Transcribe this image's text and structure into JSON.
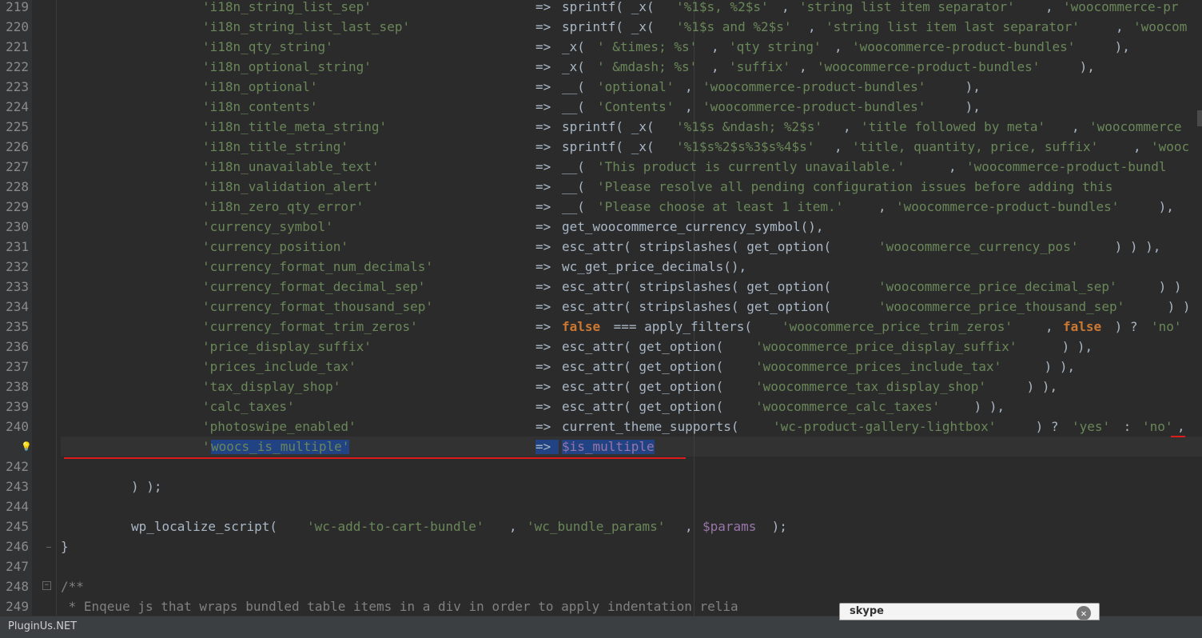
{
  "brand": "PluginUs.NET",
  "popup": {
    "logo": "skype",
    "close_glyph": "✕"
  },
  "lines": [
    {
      "n": "219",
      "tokens": [
        {
          "t": "'i18n_string_list_sep'",
          "c": "s"
        },
        {
          "t": "=> ",
          "c": "p",
          "col": 670
        },
        {
          "t": "sprintf( _x( ",
          "c": "p"
        },
        {
          "t": "'%1$s, %2$s'",
          "c": "s"
        },
        {
          "t": ", ",
          "c": "p"
        },
        {
          "t": "'string list item separator'",
          "c": "s"
        },
        {
          "t": ", ",
          "c": "p"
        },
        {
          "t": "'woocommerce-pr",
          "c": "s"
        }
      ]
    },
    {
      "n": "220",
      "tokens": [
        {
          "t": "'i18n_string_list_last_sep'",
          "c": "s"
        },
        {
          "t": "=> ",
          "c": "p",
          "col": 670
        },
        {
          "t": "sprintf( _x( ",
          "c": "p"
        },
        {
          "t": "'%1$s and %2$s'",
          "c": "s"
        },
        {
          "t": ", ",
          "c": "p"
        },
        {
          "t": "'string list item last separator'",
          "c": "s"
        },
        {
          "t": ", ",
          "c": "p"
        },
        {
          "t": "'woocom",
          "c": "s"
        }
      ]
    },
    {
      "n": "221",
      "tokens": [
        {
          "t": "'i18n_qty_string'",
          "c": "s"
        },
        {
          "t": "=> ",
          "c": "p",
          "col": 670
        },
        {
          "t": "_x( ",
          "c": "p"
        },
        {
          "t": "' &times; %s'",
          "c": "s"
        },
        {
          "t": ", ",
          "c": "p"
        },
        {
          "t": "'qty string'",
          "c": "s"
        },
        {
          "t": ", ",
          "c": "p"
        },
        {
          "t": "'woocommerce-product-bundles'",
          "c": "s"
        },
        {
          "t": " ),",
          "c": "p"
        }
      ]
    },
    {
      "n": "222",
      "tokens": [
        {
          "t": "'i18n_optional_string'",
          "c": "s"
        },
        {
          "t": "=> ",
          "c": "p",
          "col": 670
        },
        {
          "t": "_x( ",
          "c": "p"
        },
        {
          "t": "' &mdash; %s'",
          "c": "s"
        },
        {
          "t": ", ",
          "c": "p"
        },
        {
          "t": "'suffix'",
          "c": "s"
        },
        {
          "t": ", ",
          "c": "p"
        },
        {
          "t": "'woocommerce-product-bundles'",
          "c": "s"
        },
        {
          "t": " ),",
          "c": "p"
        }
      ]
    },
    {
      "n": "223",
      "tokens": [
        {
          "t": "'i18n_optional'",
          "c": "s"
        },
        {
          "t": "=> ",
          "c": "p",
          "col": 670
        },
        {
          "t": "__( ",
          "c": "p"
        },
        {
          "t": "'optional'",
          "c": "s"
        },
        {
          "t": ", ",
          "c": "p"
        },
        {
          "t": "'woocommerce-product-bundles'",
          "c": "s"
        },
        {
          "t": " ),",
          "c": "p"
        }
      ]
    },
    {
      "n": "224",
      "tokens": [
        {
          "t": "'i18n_contents'",
          "c": "s"
        },
        {
          "t": "=> ",
          "c": "p",
          "col": 670
        },
        {
          "t": "__( ",
          "c": "p"
        },
        {
          "t": "'Contents'",
          "c": "s"
        },
        {
          "t": ", ",
          "c": "p"
        },
        {
          "t": "'woocommerce-product-bundles'",
          "c": "s"
        },
        {
          "t": " ),",
          "c": "p"
        }
      ]
    },
    {
      "n": "225",
      "tokens": [
        {
          "t": "'i18n_title_meta_string'",
          "c": "s"
        },
        {
          "t": "=> ",
          "c": "p",
          "col": 670
        },
        {
          "t": "sprintf( _x( ",
          "c": "p"
        },
        {
          "t": "'%1$s &ndash; %2$s'",
          "c": "s"
        },
        {
          "t": ", ",
          "c": "p"
        },
        {
          "t": "'title followed by meta'",
          "c": "s"
        },
        {
          "t": ", ",
          "c": "p"
        },
        {
          "t": "'woocommerce",
          "c": "s"
        }
      ]
    },
    {
      "n": "226",
      "tokens": [
        {
          "t": "'i18n_title_string'",
          "c": "s"
        },
        {
          "t": "=> ",
          "c": "p",
          "col": 670
        },
        {
          "t": "sprintf( _x( ",
          "c": "p"
        },
        {
          "t": "'%1$s%2$s%3$s%4$s'",
          "c": "s"
        },
        {
          "t": ", ",
          "c": "p"
        },
        {
          "t": "'title, quantity, price, suffix'",
          "c": "s"
        },
        {
          "t": ", ",
          "c": "p"
        },
        {
          "t": "'wooc",
          "c": "s"
        }
      ]
    },
    {
      "n": "227",
      "tokens": [
        {
          "t": "'i18n_unavailable_text'",
          "c": "s"
        },
        {
          "t": "=> ",
          "c": "p",
          "col": 670
        },
        {
          "t": "__( ",
          "c": "p"
        },
        {
          "t": "'This product is currently unavailable.'",
          "c": "s"
        },
        {
          "t": ", ",
          "c": "p"
        },
        {
          "t": "'woocommerce-product-bundl",
          "c": "s"
        }
      ]
    },
    {
      "n": "228",
      "tokens": [
        {
          "t": "'i18n_validation_alert'",
          "c": "s"
        },
        {
          "t": "=> ",
          "c": "p",
          "col": 670
        },
        {
          "t": "__( ",
          "c": "p"
        },
        {
          "t": "'Please resolve all pending configuration issues before adding this",
          "c": "s"
        }
      ]
    },
    {
      "n": "229",
      "tokens": [
        {
          "t": "'i18n_zero_qty_error'",
          "c": "s"
        },
        {
          "t": "=> ",
          "c": "p",
          "col": 670
        },
        {
          "t": "__( ",
          "c": "p"
        },
        {
          "t": "'Please choose at least 1 item.'",
          "c": "s"
        },
        {
          "t": ", ",
          "c": "p"
        },
        {
          "t": "'woocommerce-product-bundles'",
          "c": "s"
        },
        {
          "t": " ),",
          "c": "p"
        }
      ]
    },
    {
      "n": "230",
      "tokens": [
        {
          "t": "'currency_symbol'",
          "c": "s"
        },
        {
          "t": "=> ",
          "c": "p",
          "col": 670
        },
        {
          "t": "get_woocommerce_currency_symbol(),",
          "c": "p"
        }
      ]
    },
    {
      "n": "231",
      "tokens": [
        {
          "t": "'currency_position'",
          "c": "s"
        },
        {
          "t": "=> ",
          "c": "p",
          "col": 670
        },
        {
          "t": "esc_attr( stripslashes( get_option( ",
          "c": "p"
        },
        {
          "t": "'woocommerce_currency_pos'",
          "c": "s"
        },
        {
          "t": " ) ) ),",
          "c": "p"
        }
      ]
    },
    {
      "n": "232",
      "tokens": [
        {
          "t": "'currency_format_num_decimals'",
          "c": "s"
        },
        {
          "t": "=> ",
          "c": "p",
          "col": 670
        },
        {
          "t": "wc_get_price_decimals(),",
          "c": "p"
        }
      ]
    },
    {
      "n": "233",
      "tokens": [
        {
          "t": "'currency_format_decimal_sep'",
          "c": "s"
        },
        {
          "t": "=> ",
          "c": "p",
          "col": 670
        },
        {
          "t": "esc_attr( stripslashes( get_option( ",
          "c": "p"
        },
        {
          "t": "'woocommerce_price_decimal_sep'",
          "c": "s"
        },
        {
          "t": " ) )",
          "c": "p"
        }
      ]
    },
    {
      "n": "234",
      "tokens": [
        {
          "t": "'currency_format_thousand_sep'",
          "c": "s"
        },
        {
          "t": "=> ",
          "c": "p",
          "col": 670
        },
        {
          "t": "esc_attr( stripslashes( get_option( ",
          "c": "p"
        },
        {
          "t": "'woocommerce_price_thousand_sep'",
          "c": "s"
        },
        {
          "t": " ) )",
          "c": "p"
        }
      ]
    },
    {
      "n": "235",
      "tokens": [
        {
          "t": "'currency_format_trim_zeros'",
          "c": "s"
        },
        {
          "t": "=> ",
          "c": "p",
          "col": 670
        },
        {
          "t": "false",
          "c": "k"
        },
        {
          "t": " === apply_filters( ",
          "c": "p"
        },
        {
          "t": "'woocommerce_price_trim_zeros'",
          "c": "s"
        },
        {
          "t": ", ",
          "c": "p"
        },
        {
          "t": "false",
          "c": "k"
        },
        {
          "t": " ) ? ",
          "c": "p"
        },
        {
          "t": "'no'",
          "c": "s"
        }
      ]
    },
    {
      "n": "236",
      "tokens": [
        {
          "t": "'price_display_suffix'",
          "c": "s"
        },
        {
          "t": "=> ",
          "c": "p",
          "col": 670
        },
        {
          "t": "esc_attr( get_option( ",
          "c": "p"
        },
        {
          "t": "'woocommerce_price_display_suffix'",
          "c": "s"
        },
        {
          "t": " ) ),",
          "c": "p"
        }
      ]
    },
    {
      "n": "237",
      "tokens": [
        {
          "t": "'prices_include_tax'",
          "c": "s"
        },
        {
          "t": "=> ",
          "c": "p",
          "col": 670
        },
        {
          "t": "esc_attr( get_option( ",
          "c": "p"
        },
        {
          "t": "'woocommerce_prices_include_tax'",
          "c": "s"
        },
        {
          "t": " ) ),",
          "c": "p"
        }
      ]
    },
    {
      "n": "238",
      "tokens": [
        {
          "t": "'tax_display_shop'",
          "c": "s"
        },
        {
          "t": "=> ",
          "c": "p",
          "col": 670
        },
        {
          "t": "esc_attr( get_option( ",
          "c": "p"
        },
        {
          "t": "'woocommerce_tax_display_shop'",
          "c": "s"
        },
        {
          "t": " ) ),",
          "c": "p"
        }
      ]
    },
    {
      "n": "239",
      "tokens": [
        {
          "t": "'calc_taxes'",
          "c": "s"
        },
        {
          "t": "=> ",
          "c": "p",
          "col": 670
        },
        {
          "t": "esc_attr( get_option( ",
          "c": "p"
        },
        {
          "t": "'woocommerce_calc_taxes'",
          "c": "s"
        },
        {
          "t": " ) ),",
          "c": "p"
        }
      ]
    },
    {
      "n": "240",
      "tokens": [
        {
          "t": "'photoswipe_enabled'",
          "c": "s"
        },
        {
          "t": "=> ",
          "c": "p",
          "col": 670
        },
        {
          "t": "current_theme_supports( ",
          "c": "p"
        },
        {
          "t": "'wc-product-gallery-lightbox'",
          "c": "s"
        },
        {
          "t": " ) ? ",
          "c": "p"
        },
        {
          "t": "'yes'",
          "c": "s"
        },
        {
          "t": " : ",
          "c": "p"
        },
        {
          "t": "'no'",
          "c": "s"
        },
        {
          "t": ",",
          "c": "p"
        }
      ]
    },
    {
      "n": "",
      "tokens": [
        {
          "t": "'",
          "c": "s"
        },
        {
          "t": "woocs_is_multiple'",
          "c": "s",
          "sel": true
        },
        {
          "t": "=> ",
          "c": "p",
          "col": 670,
          "sel": true
        },
        {
          "t": "$is_multiple",
          "c": "v",
          "sel": true
        }
      ]
    },
    {
      "n": "242",
      "tokens": []
    },
    {
      "n": "243",
      "tokens": [
        {
          "t": ") );",
          "c": "p",
          "col": 164
        }
      ]
    },
    {
      "n": "244",
      "tokens": []
    },
    {
      "n": "245",
      "tokens": [
        {
          "t": "wp_localize_script( ",
          "c": "p",
          "col": 164
        },
        {
          "t": "'wc-add-to-cart-bundle'",
          "c": "s"
        },
        {
          "t": ", ",
          "c": "p"
        },
        {
          "t": "'wc_bundle_params'",
          "c": "s"
        },
        {
          "t": ", ",
          "c": "p"
        },
        {
          "t": "$params",
          "c": "v"
        },
        {
          "t": " );",
          "c": "p"
        }
      ]
    },
    {
      "n": "246",
      "tokens": [
        {
          "t": "}",
          "c": "p",
          "col": 76
        }
      ]
    },
    {
      "n": "247",
      "tokens": []
    },
    {
      "n": "248",
      "tokens": [
        {
          "t": "/**",
          "c": "c",
          "col": 76
        }
      ]
    },
    {
      "n": "249",
      "tokens": [
        {
          "t": " * Enqeue js that wraps bundled table items in a div in order to apply indentation relia",
          "c": "c",
          "col": 76
        }
      ]
    }
  ]
}
